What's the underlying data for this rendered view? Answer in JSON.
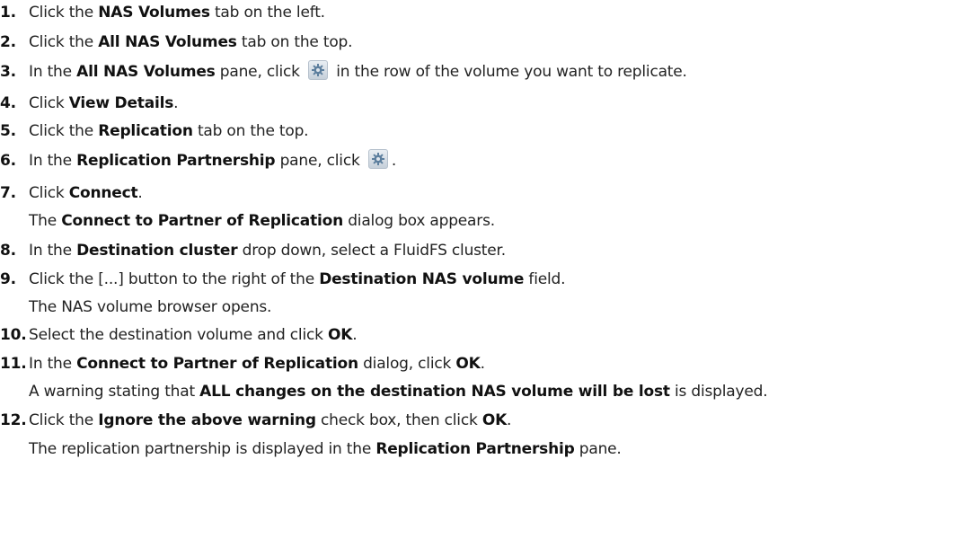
{
  "steps": [
    {
      "n": "1.",
      "parts": [
        {
          "t": "Click the "
        },
        {
          "t": "NAS Volumes",
          "b": true
        },
        {
          "t": " tab on the left."
        }
      ]
    },
    {
      "n": "2.",
      "parts": [
        {
          "t": "Click the "
        },
        {
          "t": "All NAS Volumes",
          "b": true
        },
        {
          "t": " tab on the top."
        }
      ]
    },
    {
      "n": "3.",
      "parts": [
        {
          "t": "In the "
        },
        {
          "t": "All NAS Volumes",
          "b": true
        },
        {
          "t": " pane, click "
        },
        {
          "icon": "gear-icon"
        },
        {
          "t": " in the row of the volume you want to replicate."
        }
      ]
    },
    {
      "n": "4.",
      "parts": [
        {
          "t": "Click "
        },
        {
          "t": "View Details",
          "b": true
        },
        {
          "t": "."
        }
      ]
    },
    {
      "n": "5.",
      "parts": [
        {
          "t": "Click the "
        },
        {
          "t": "Replication",
          "b": true
        },
        {
          "t": " tab on the top."
        }
      ]
    },
    {
      "n": "6.",
      "parts": [
        {
          "t": "In the "
        },
        {
          "t": "Replication Partnership",
          "b": true
        },
        {
          "t": " pane, click "
        },
        {
          "icon": "gear-icon"
        },
        {
          "t": "."
        }
      ]
    },
    {
      "n": "7.",
      "parts": [
        {
          "t": "Click "
        },
        {
          "t": "Connect",
          "b": true
        },
        {
          "t": "."
        }
      ]
    },
    {
      "n": "",
      "parts": [
        {
          "t": "The "
        },
        {
          "t": "Connect to Partner of Replication",
          "b": true
        },
        {
          "t": " dialog box appears."
        }
      ]
    },
    {
      "n": "8.",
      "parts": [
        {
          "t": "In the "
        },
        {
          "t": "Destination cluster",
          "b": true
        },
        {
          "t": " drop down, select a FluidFS cluster."
        }
      ]
    },
    {
      "n": "9.",
      "parts": [
        {
          "t": "Click the [...] button to the right of the "
        },
        {
          "t": "Destination NAS volume",
          "b": true
        },
        {
          "t": " field."
        }
      ]
    },
    {
      "n": "",
      "parts": [
        {
          "t": "The NAS volume browser opens."
        }
      ]
    },
    {
      "n": "10.",
      "parts": [
        {
          "t": "Select the destination volume and click "
        },
        {
          "t": "OK",
          "b": true
        },
        {
          "t": "."
        }
      ]
    },
    {
      "n": "11.",
      "parts": [
        {
          "t": "In the "
        },
        {
          "t": "Connect to Partner of Replication",
          "b": true
        },
        {
          "t": " dialog, click "
        },
        {
          "t": "OK",
          "b": true
        },
        {
          "t": "."
        }
      ]
    },
    {
      "n": "",
      "parts": [
        {
          "t": "A warning stating that "
        },
        {
          "t": "ALL changes on the destination NAS volume will be lost",
          "b": true
        },
        {
          "t": " is displayed."
        }
      ]
    },
    {
      "n": "12.",
      "parts": [
        {
          "t": "Click the "
        },
        {
          "t": "Ignore the above warning",
          "b": true
        },
        {
          "t": " check box, then click "
        },
        {
          "t": "OK",
          "b": true
        },
        {
          "t": "."
        }
      ]
    },
    {
      "n": "",
      "parts": [
        {
          "t": "The replication partnership is displayed in the "
        },
        {
          "t": "Replication Partnership",
          "b": true
        },
        {
          "t": " pane."
        }
      ]
    }
  ]
}
